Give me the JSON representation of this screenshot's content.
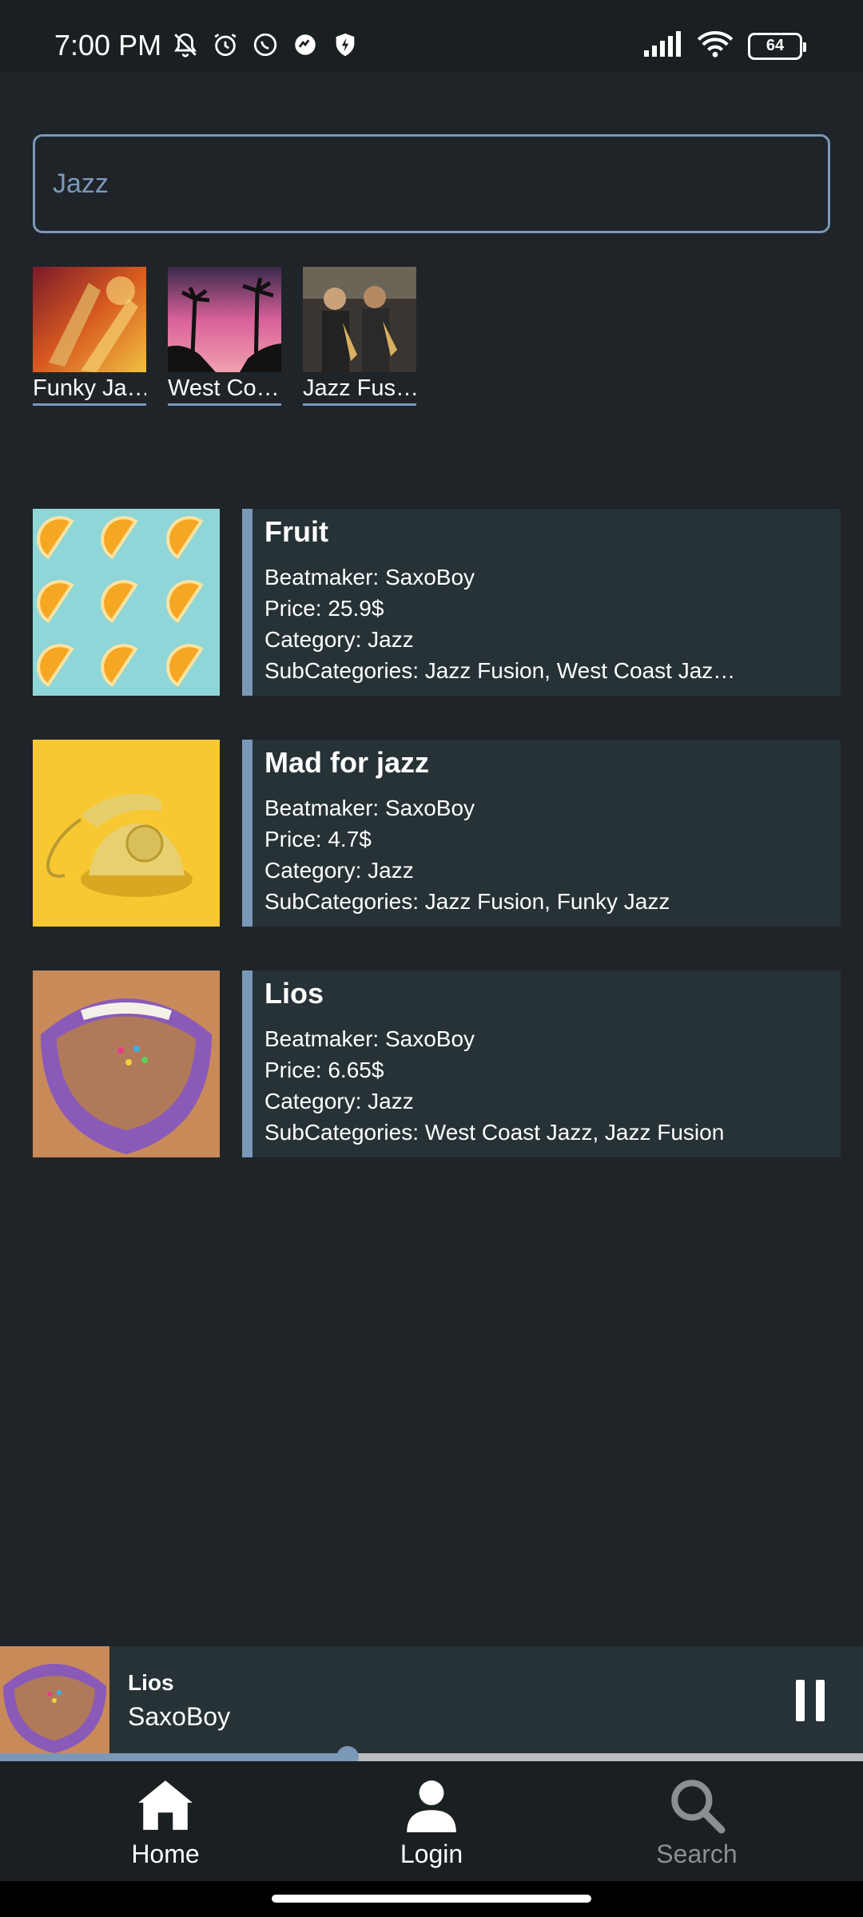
{
  "status_bar": {
    "time": "7:00 PM",
    "battery": "64"
  },
  "search": {
    "value": "Jazz",
    "placeholder": ""
  },
  "subcategories": [
    {
      "label": "Funky Ja…"
    },
    {
      "label": "West Co…"
    },
    {
      "label": "Jazz Fus…"
    }
  ],
  "beats": [
    {
      "title": "Fruit",
      "beatmaker": "Beatmaker: SaxoBoy",
      "price": "Price: 25.9$",
      "category": "Category: Jazz",
      "subcategories": "SubCategories: Jazz Fusion, West Coast Jaz…"
    },
    {
      "title": "Mad for jazz",
      "beatmaker": "Beatmaker: SaxoBoy",
      "price": "Price: 4.7$",
      "category": "Category: Jazz",
      "subcategories": "SubCategories: Jazz Fusion, Funky Jazz"
    },
    {
      "title": "Lios",
      "beatmaker": "Beatmaker: SaxoBoy",
      "price": "Price: 6.65$",
      "category": "Category: Jazz",
      "subcategories": "SubCategories: West Coast Jazz, Jazz Fusion"
    }
  ],
  "player": {
    "title": "Lios",
    "artist": "SaxoBoy",
    "progress": 0.403
  },
  "nav": {
    "home": "Home",
    "login": "Login",
    "search": "Search"
  },
  "colors": {
    "accent": "#7a98b8",
    "background": "#1f2429",
    "card": "#263236"
  }
}
